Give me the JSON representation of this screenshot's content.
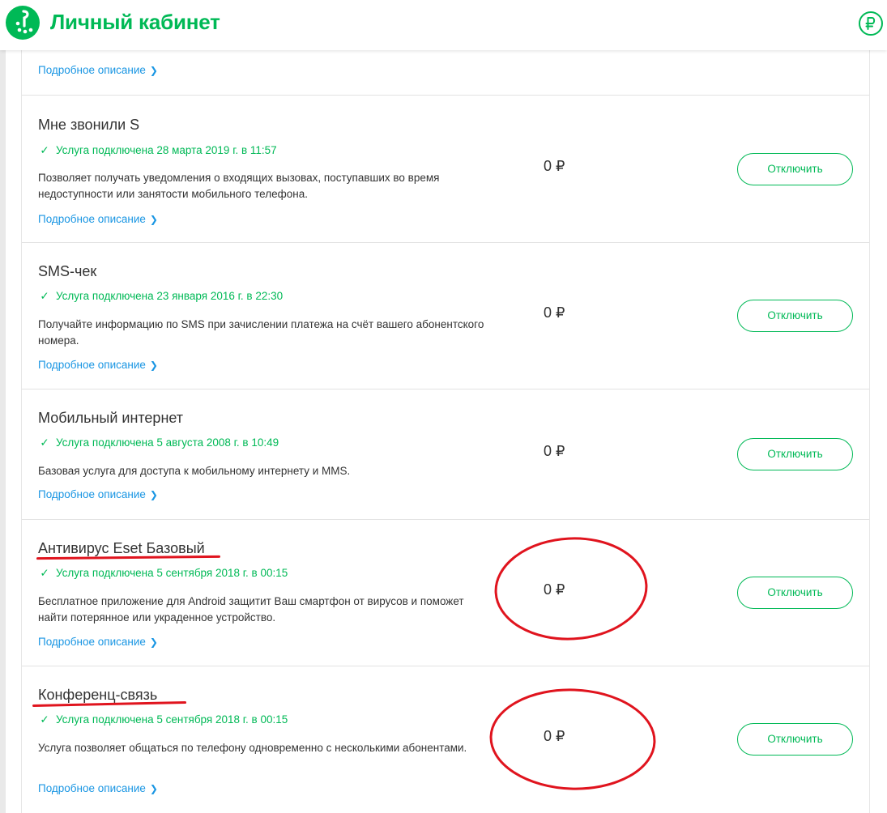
{
  "header": {
    "title": "Личный кабинет",
    "logo_icon": "megafon-logo-icon",
    "balance_icon": "ruble-circle-icon",
    "accent_color": "#00b956"
  },
  "previous_item": {
    "more_label": "Подробное описание"
  },
  "services": [
    {
      "title": "Мне звонили S",
      "status": "Услуга подключена 28 марта 2019 г. в 11:57",
      "description": "Позволяет получать уведомления о входящих вызовах, поступавших во время недоступности или занятости мобильного телефона.",
      "more_label": "Подробное описание",
      "price": "0 ₽",
      "button_label": "Отключить"
    },
    {
      "title": "SMS-чек",
      "status": "Услуга подключена 23 января 2016 г. в 22:30",
      "description": "Получайте информацию по SMS при зачислении платежа на счёт вашего абонентского номера.",
      "more_label": "Подробное описание",
      "price": "0 ₽",
      "button_label": "Отключить"
    },
    {
      "title": "Мобильный интернет",
      "status": "Услуга подключена 5 августа 2008 г. в 10:49",
      "description": "Базовая услуга для доступа к мобильному интернету и MMS.",
      "more_label": "Подробное описание",
      "price": "0 ₽",
      "button_label": "Отключить"
    },
    {
      "title": "Антивирус Eset Базовый",
      "status": "Услуга подключена 5 сентября 2018 г. в 00:15",
      "description": "Бесплатное приложение для Android защитит Ваш смартфон от вирусов и поможет найти потерянное или украденное устройство.",
      "more_label": "Подробное описание",
      "price": "0 ₽",
      "button_label": "Отключить"
    },
    {
      "title": "Конференц-связь",
      "status": "Услуга подключена 5 сентября 2018 г. в 00:15",
      "description": "Услуга позволяет общаться по телефону одновременно с несколькими абонентами.",
      "more_label": "Подробное описание",
      "price": "0 ₽",
      "button_label": "Отключить"
    }
  ],
  "colors": {
    "brand_green": "#00b956",
    "link_blue": "#1a96e3",
    "annotation_red": "#e0141e",
    "divider": "#e3e3e3"
  }
}
